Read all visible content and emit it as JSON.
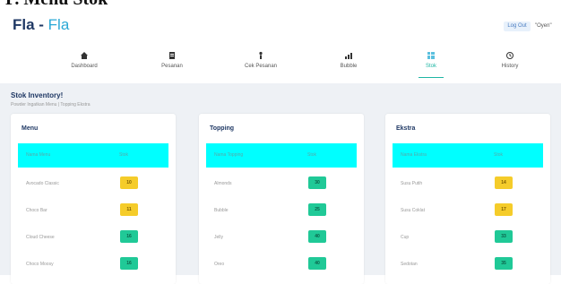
{
  "document_heading": "P. Menu Stok",
  "app": {
    "brand": "Fla",
    "brand_separator": " - ",
    "brand_sub": "Fla"
  },
  "header": {
    "logout_label": "Log Out",
    "username": "\"Oyen\""
  },
  "nav": [
    {
      "icon": "home-icon",
      "label": "Dashboard"
    },
    {
      "icon": "clipboard-icon",
      "label": "Pesanan"
    },
    {
      "icon": "person-icon",
      "label": "Cek Pesanan"
    },
    {
      "icon": "bar-chart-icon",
      "label": "Bubble"
    },
    {
      "icon": "grid-icon",
      "label": "Stok",
      "active": true
    },
    {
      "icon": "history-icon",
      "label": "History"
    }
  ],
  "page": {
    "title": "Stok Inventory!",
    "subtitle": "Powder Ingatkan Menu | Topping Ekstra"
  },
  "cards": [
    {
      "title": "Menu",
      "headers": [
        "Nama Menu",
        "Stok"
      ],
      "rows": [
        {
          "name": "Avocado Classic",
          "stock": "10",
          "status": "low"
        },
        {
          "name": "Choco Bar",
          "stock": "11",
          "status": "low"
        },
        {
          "name": "Cloud Cheese",
          "stock": "16",
          "status": "ok"
        },
        {
          "name": "Choco Moosy",
          "stock": "16",
          "status": "ok"
        }
      ]
    },
    {
      "title": "Topping",
      "headers": [
        "Nama Topping",
        "Stok"
      ],
      "rows": [
        {
          "name": "Almonds",
          "stock": "30",
          "status": "ok"
        },
        {
          "name": "Bubble",
          "stock": "25",
          "status": "ok"
        },
        {
          "name": "Jelly",
          "stock": "40",
          "status": "ok"
        },
        {
          "name": "Oreo",
          "stock": "40",
          "status": "ok"
        }
      ]
    },
    {
      "title": "Ekstra",
      "headers": [
        "Nama Ekstra",
        "Stok"
      ],
      "rows": [
        {
          "name": "Susu Putih",
          "stock": "14",
          "status": "low"
        },
        {
          "name": "Susu Coklat",
          "stock": "17",
          "status": "low"
        },
        {
          "name": "Cup",
          "stock": "33",
          "status": "ok"
        },
        {
          "name": "Sedotan",
          "stock": "35",
          "status": "ok"
        }
      ]
    }
  ],
  "colors": {
    "brand_dark": "#1f3864",
    "brand_accent": "#2aa8d6",
    "table_header": "#00ffff",
    "badge_low": "#f5cc2a",
    "badge_ok": "#20c997",
    "nav_active": "#1fb6a4"
  }
}
